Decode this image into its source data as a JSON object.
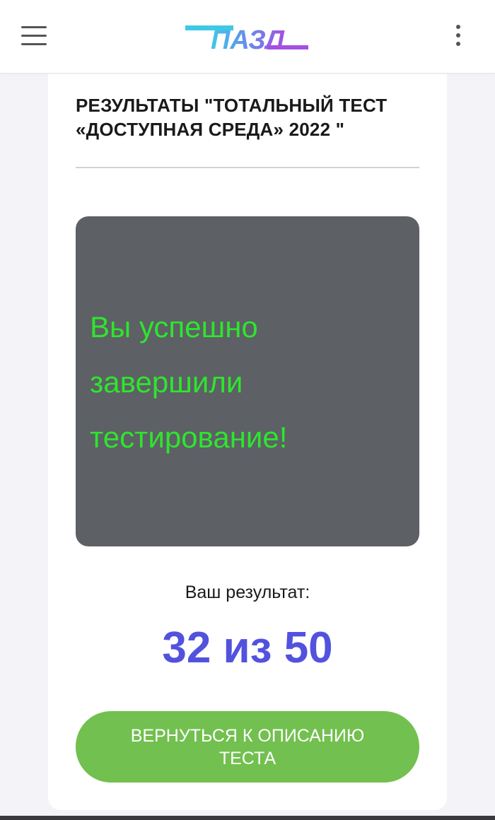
{
  "header": {
    "logo_text": "ПАЗЛ",
    "menu_icon": "hamburger-menu-icon",
    "more_icon": "kebab-menu-icon"
  },
  "page": {
    "title": "РЕЗУЛЬТАТЫ \"ТОТАЛЬНЫЙ ТЕСТ «ДОСТУПНАЯ СРЕДА» 2022 \""
  },
  "result": {
    "message": "Вы успешно завершили тестирование!",
    "score_label": "Ваш результат:",
    "score_value": "32 из 50",
    "back_button_label": "ВЕРНУТЬСЯ К ОПИСАНИЮ ТЕСТА"
  },
  "colors": {
    "accent_purple": "#5252de",
    "success_green": "#2ee52e",
    "button_green": "#72c04f",
    "box_gray": "#5d6064"
  }
}
